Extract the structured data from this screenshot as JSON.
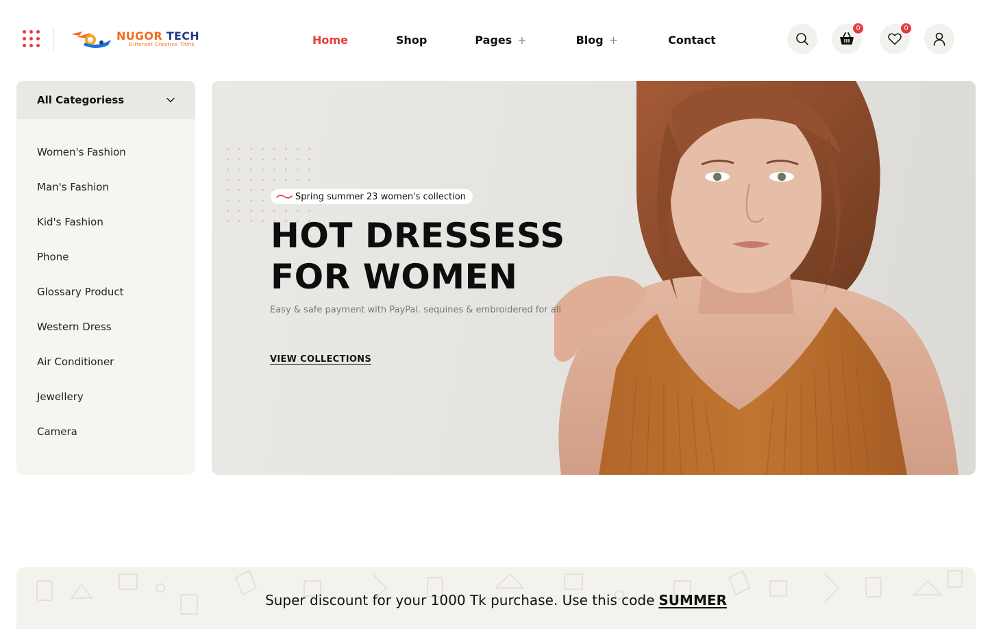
{
  "brand": {
    "name_primary": "NUGOR",
    "name_secondary": "TECH",
    "tagline": "Different Creative Think",
    "accent_color": "#e53b3b",
    "logo_color": "#f26b1d"
  },
  "header": {
    "nav": [
      {
        "label": "Home",
        "active": true,
        "has_submenu": false
      },
      {
        "label": "Shop",
        "active": false,
        "has_submenu": false
      },
      {
        "label": "Pages",
        "active": false,
        "has_submenu": true
      },
      {
        "label": "Blog",
        "active": false,
        "has_submenu": true
      },
      {
        "label": "Contact",
        "active": false,
        "has_submenu": false
      }
    ],
    "submenu_symbol": "+",
    "actions": {
      "search_icon": "search-icon",
      "cart_icon": "basket-icon",
      "cart_count": "0",
      "wishlist_icon": "heart-icon",
      "wishlist_count": "0",
      "account_icon": "user-icon"
    }
  },
  "sidebar": {
    "title": "All Categoriess",
    "items": [
      {
        "label": "Women's Fashion"
      },
      {
        "label": "Man's Fashion"
      },
      {
        "label": "Kid's Fashion"
      },
      {
        "label": "Phone"
      },
      {
        "label": "Glossary Product"
      },
      {
        "label": "Western Dress"
      },
      {
        "label": "Air Conditioner"
      },
      {
        "label": "Jewellery"
      },
      {
        "label": "Camera"
      }
    ]
  },
  "hero": {
    "tag": "Spring summer 23 women's collection",
    "title_line1": "HOT DRESSESS",
    "title_line2": "FOR WOMEN",
    "subtitle": "Easy & safe payment with PayPal. sequines & embroidered for all",
    "cta": "VIEW COLLECTIONS"
  },
  "promo": {
    "text": "Super discount for your 1000 Tk purchase. Use this code",
    "code": "SUMMER"
  }
}
